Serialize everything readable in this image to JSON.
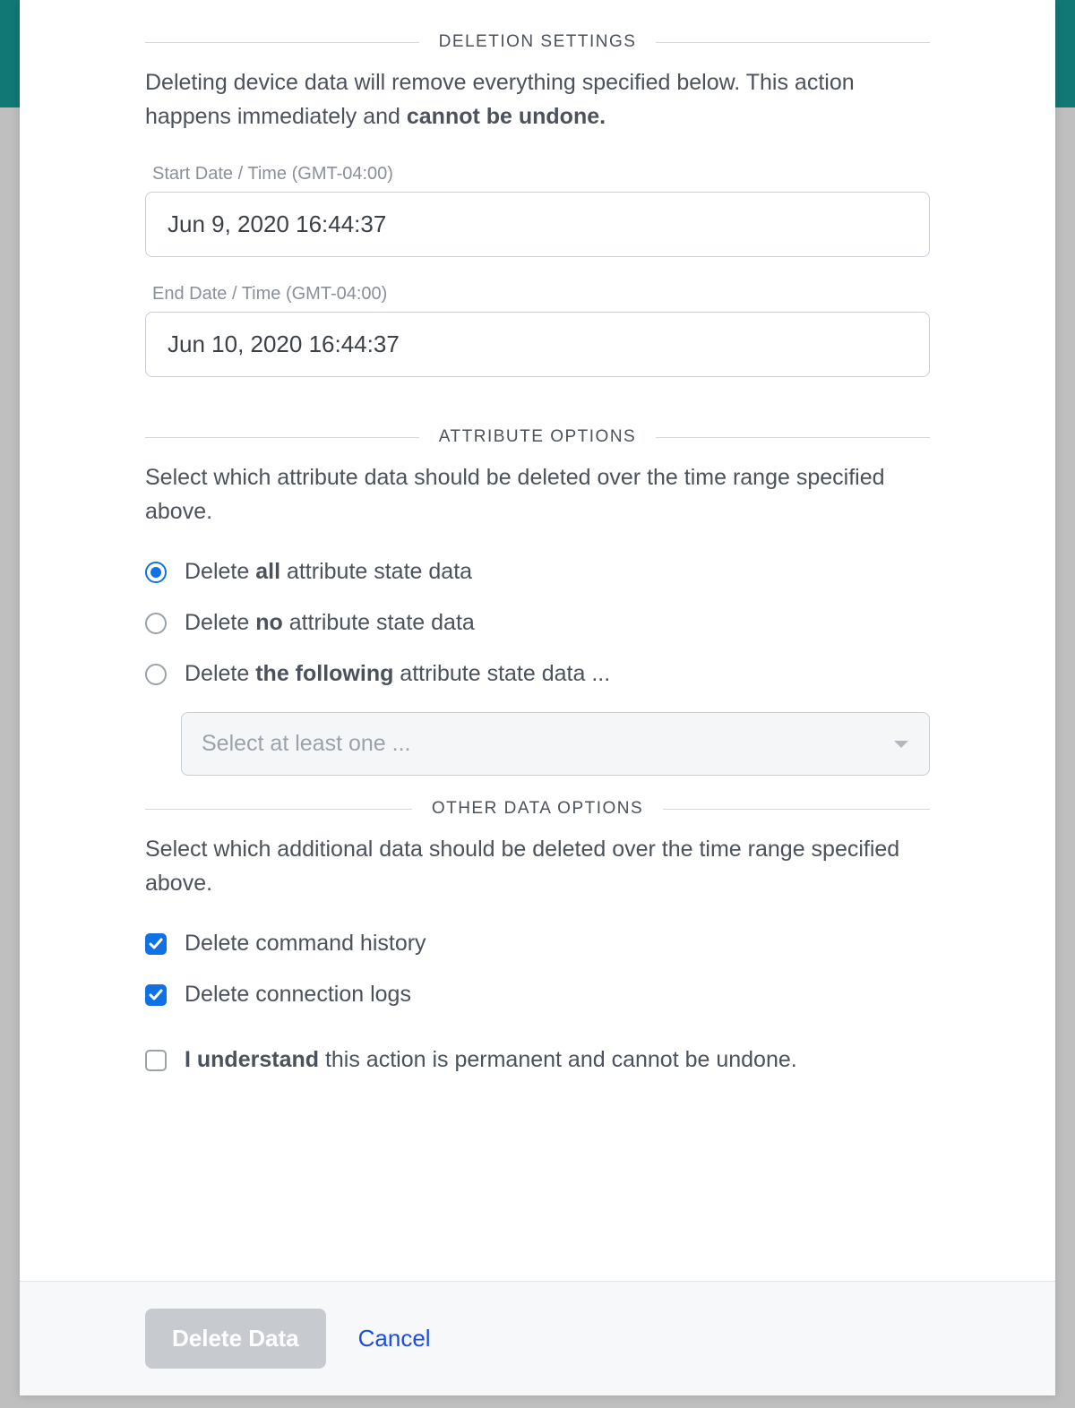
{
  "sections": {
    "deletion": {
      "title": "DELETION SETTINGS",
      "description_pre": "Deleting device data will remove everything specified below. This action happens immediately and ",
      "description_bold": "cannot be undone.",
      "start_label": "Start Date / Time (GMT-04:00)",
      "start_value": "Jun 9, 2020 16:44:37",
      "end_label": "End Date / Time (GMT-04:00)",
      "end_value": "Jun 10, 2020 16:44:37"
    },
    "attribute": {
      "title": "ATTRIBUTE OPTIONS",
      "description": "Select which attribute data should be deleted over the time range specified above.",
      "opt_all_pre": "Delete ",
      "opt_all_bold": "all",
      "opt_all_post": " attribute state data",
      "opt_none_pre": "Delete ",
      "opt_none_bold": "no",
      "opt_none_post": " attribute state data",
      "opt_following_pre": "Delete ",
      "opt_following_bold": "the following",
      "opt_following_post": " attribute state data ...",
      "select_placeholder": "Select at least one ..."
    },
    "other": {
      "title": "OTHER DATA OPTIONS",
      "description": "Select which additional data should be deleted over the time range specified above.",
      "cmd_history_label": "Delete command history",
      "conn_logs_label": "Delete connection logs",
      "confirm_bold": "I understand",
      "confirm_post": " this action is permanent and cannot be undone."
    }
  },
  "footer": {
    "delete_label": "Delete Data",
    "cancel_label": "Cancel"
  },
  "state": {
    "attribute_selected": "all",
    "cmd_history_checked": true,
    "conn_logs_checked": true,
    "confirm_checked": false
  }
}
